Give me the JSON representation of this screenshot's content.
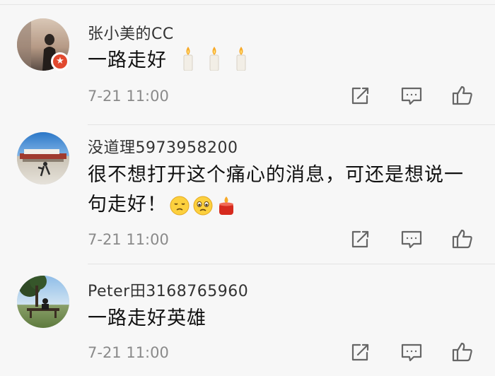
{
  "comments": [
    {
      "username": "张小美的CC",
      "content_text": "一路走好",
      "content_emojis": [
        "candle-emoji",
        "candle-emoji",
        "candle-emoji"
      ],
      "time": "7-21 11:00",
      "has_badge": true
    },
    {
      "username": "没道理5973958200",
      "content_text": "很不想打开这个痛心的消息，可还是想说一句走好！",
      "content_emojis": [
        "sad-face-emoji",
        "teary-face-emoji",
        "candle-emoji"
      ],
      "time": "7-21 11:00"
    },
    {
      "username": "Peter田3168765960",
      "content_text": "一路走好英雄",
      "content_emojis": [],
      "time": "7-21 11:00"
    }
  ],
  "actions": [
    "share-icon",
    "comment-icon",
    "like-icon"
  ],
  "colors": {
    "background": "#f7f7f7",
    "text_primary": "#111111",
    "username": "#333333",
    "time": "#8a8a8a",
    "badge": "#e2492f",
    "icon": "#666666"
  }
}
